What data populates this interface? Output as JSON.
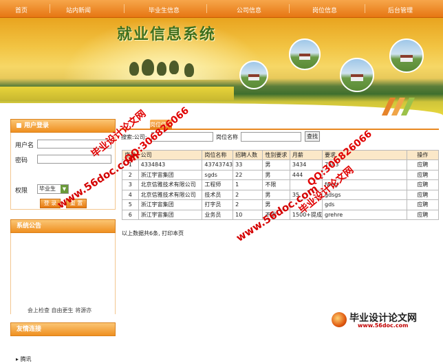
{
  "nav": {
    "items": [
      "首页",
      "站内新闻",
      "毕业生信息",
      "公司信息",
      "岗位信息",
      "后台管理"
    ]
  },
  "banner": {
    "title": "就业信息系统"
  },
  "login": {
    "title": "用户登录",
    "username_label": "用户名",
    "password_label": "密码",
    "role_label": "权限",
    "role_value": "毕业生",
    "login_button": "登 录",
    "reset_button": "重 置"
  },
  "notice": {
    "title": "系统公告",
    "marquee": "会上检查 自由更生  将源亦"
  },
  "links": {
    "title": "友情连接",
    "items": [
      "腾讯"
    ]
  },
  "main": {
    "tab_label": "岗位信息",
    "search_label": "搜索:公司:",
    "position_label": "岗位名称",
    "search_button": "查找",
    "columns": [
      "序号",
      "公司",
      "岗位名称",
      "招聘人数",
      "性别要求",
      "月薪",
      "要求",
      "操作"
    ],
    "rows": [
      [
        "1",
        "4334843",
        "43743743",
        "33",
        "男",
        "3434",
        "7343",
        "应聘"
      ],
      [
        "2",
        "浙江宇宙集团",
        "sgds",
        "22",
        "男",
        "444",
        "",
        "应聘"
      ],
      [
        "3",
        "北京信雅技术有限公司",
        "工程师",
        "1",
        "不限",
        "",
        "fweg",
        "应聘"
      ],
      [
        "4",
        "北京信雅技术有限公司",
        "技术员",
        "2",
        "男",
        "35",
        "gdsgs",
        "应聘"
      ],
      [
        "5",
        "浙江宇宙集团",
        "打字员",
        "2",
        "男",
        "",
        "gds",
        "应聘"
      ],
      [
        "6",
        "浙江宇宙集团",
        "业务员",
        "10",
        "不限",
        "1500+提成",
        "grehre",
        "应聘"
      ]
    ],
    "footer": "以上数据共6条, 打印本页"
  },
  "watermarks": {
    "brand_cn": "毕业设计论文网",
    "qq": "QQ:306826066",
    "site": "www.56doc.com"
  },
  "brand": {
    "name": "毕业设计论文网",
    "url": "www.56doc.com"
  }
}
